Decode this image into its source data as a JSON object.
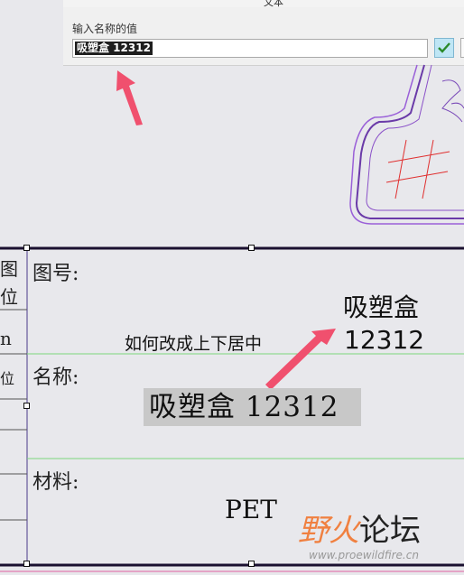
{
  "dialog": {
    "menu_label": "文本",
    "prompt_label": "输入名称的值",
    "input_value": "吸塑盒 12312"
  },
  "drawing": {
    "top_label_line1": "吸塑盒",
    "top_label_line2": "12312",
    "hint": "如何改成上下居中",
    "label_drawing_no": "图号:",
    "label_name": "名称:",
    "label_material": "材料:",
    "name_value": "吸塑盒 12312",
    "material_value": "PET",
    "edge_char_1": "图",
    "edge_char_2": "位",
    "edge_char_3": "n",
    "edge_char_4": "位"
  },
  "watermark": {
    "brand_left": "野火",
    "brand_right": "论坛",
    "url": "www.proewildfire.cn"
  },
  "colors": {
    "arrow": "#f0506e",
    "border": "#1a1030",
    "green_line": "#7bd67b"
  }
}
